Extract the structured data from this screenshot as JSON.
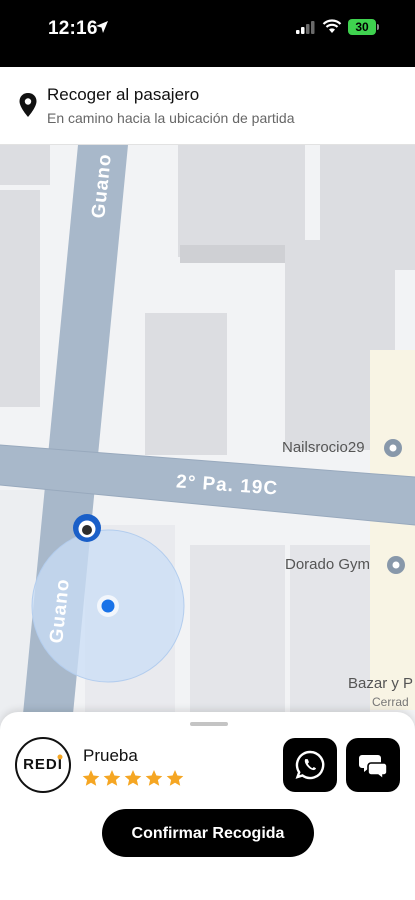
{
  "status_bar": {
    "time": "12:16",
    "battery": "30"
  },
  "header": {
    "title": "Recoger al pasajero",
    "subtitle": "En camino hacia la ubicación de partida"
  },
  "map": {
    "streets": {
      "vertical": "Guano",
      "horizontal": "2° Pa. 19C"
    },
    "pois": [
      "Nailsrocio29",
      "Dorado Gym",
      "Bazar y P",
      "Cerrad"
    ]
  },
  "driver": {
    "avatar_text": "REDI",
    "name": "Prueba",
    "rating": 5,
    "rating_max": 5
  },
  "actions": {
    "confirm_label": "Confirmar Recogida"
  },
  "colors": {
    "accent": "#000000",
    "star": "#f5a623",
    "battery": "#3fd24f",
    "road": "#a8b8ca",
    "location": "#1a73e8"
  }
}
